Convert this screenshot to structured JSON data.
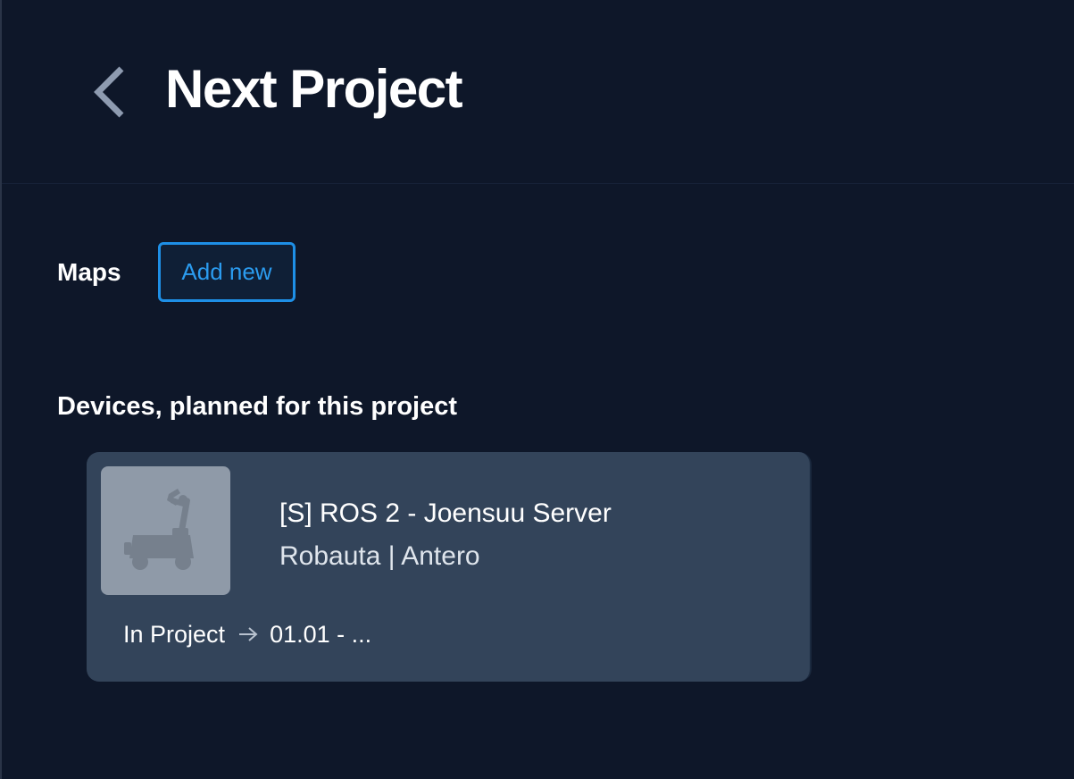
{
  "header": {
    "back_icon": "chevron-left-icon",
    "title": "Next Project"
  },
  "maps": {
    "label": "Maps",
    "add_new_label": "Add new"
  },
  "devices": {
    "heading": "Devices, planned for this project",
    "items": [
      {
        "icon": "robot-vehicle-icon",
        "name": "[S] ROS 2 - Joensuu Server",
        "subtitle": "Robauta | Antero",
        "status_label": "In Project",
        "status_arrow_icon": "arrow-right-icon",
        "status_value": "01.01 - ..."
      }
    ]
  },
  "colors": {
    "background": "#0e1729",
    "card": "#33445a",
    "accent": "#1e8fe6",
    "thumb": "#8f9aa8"
  }
}
